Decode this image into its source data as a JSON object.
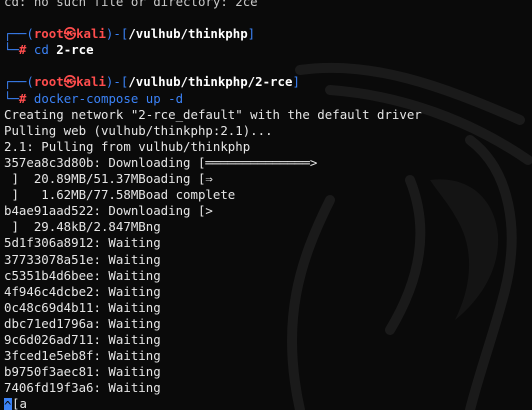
{
  "line0": "cd: no such file or directory: 2ce",
  "prompt1": {
    "open": "┌──(",
    "user": "root",
    "skull": "㉿",
    "host": "kali",
    "mid": ")-[",
    "path": "/vulhub/thinkphp",
    "close": "]",
    "prompt_prefix": "└─",
    "hash": "#",
    "command": "cd",
    "arg": "2-rce"
  },
  "prompt2": {
    "open": "┌──(",
    "user": "root",
    "skull": "㉿",
    "host": "kali",
    "mid": ")-[",
    "path": "/vulhub/thinkphp/2-rce",
    "close": "]",
    "prompt_prefix": "└─",
    "hash": "#",
    "command": "docker-compose up -d"
  },
  "output": [
    "Creating network \"2-rce_default\" with the default driver",
    "Pulling web (vulhub/thinkphp:2.1)...",
    "2.1: Pulling from vulhub/thinkphp",
    "357ea8c3d80b: Downloading [══════════════>",
    " ]  20.89MB/51.37MBoading [⇒",
    " ]   1.62MB/77.58MBoad complete",
    "b4ae91aad522: Downloading [>",
    " ]  29.48kB/2.847MBng",
    "5d1f306a8912: Waiting",
    "37733078a51e: Waiting",
    "c5351b4d6bee: Waiting",
    "4f946c4dcbe2: Waiting",
    "0c48c69d4b11: Waiting",
    "dbc71ed1796a: Waiting",
    "9c6d026ad711: Waiting",
    "3fced1e5eb8f: Waiting",
    "b9750f3aec81: Waiting",
    "7406fd19f3a6: Waiting"
  ],
  "last_line": {
    "cursor": "^",
    "text": "[a"
  },
  "colors": {
    "background": "#0a0a0a",
    "prompt_frame": "#3b82f6",
    "prompt_user": "#ff4d4d",
    "text": "#e6e6e6"
  }
}
